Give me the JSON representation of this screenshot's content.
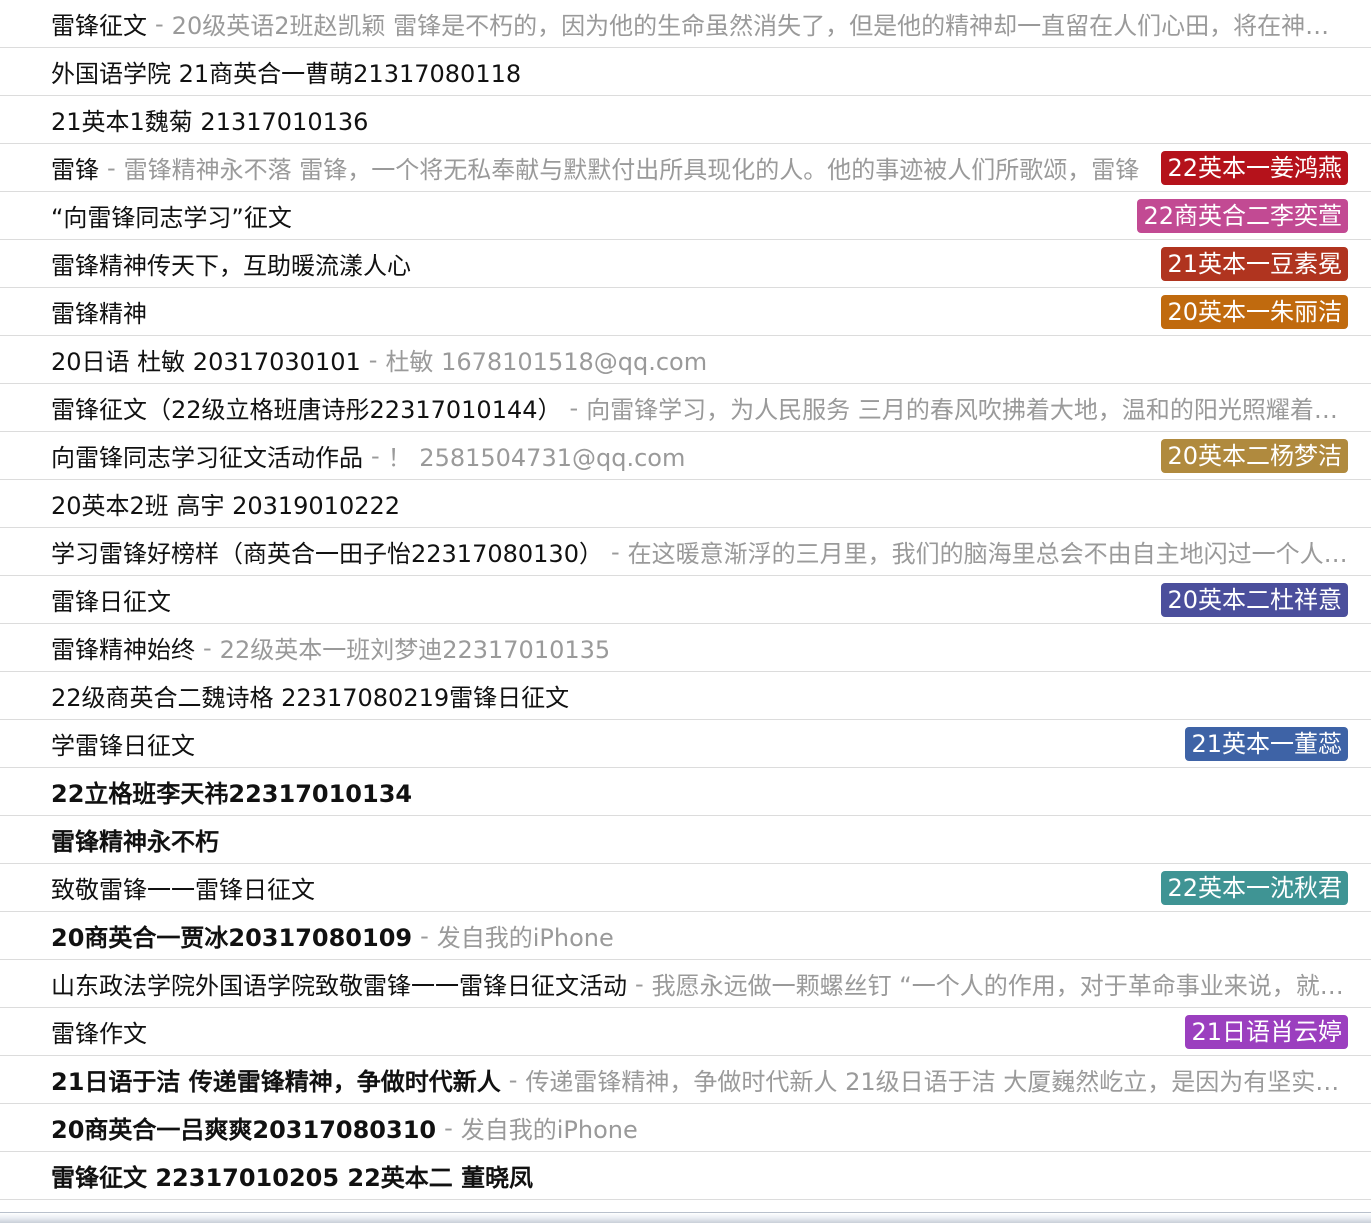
{
  "rows": [
    {
      "subject": "雷锋征文",
      "snippet": "20级英语2班赵凯颖  雷锋是不朽的，因为他的生命虽然消失了，但是他的精神却一直留在人们心田，将在神州大地上永放光芒",
      "tag": "",
      "tag_color": "",
      "unread": false
    },
    {
      "subject": "外国语学院 21商英合一曹萌21317080118",
      "snippet": "",
      "tag": "",
      "tag_color": "",
      "unread": false
    },
    {
      "subject": "21英本1魏菊 21317010136",
      "snippet": "",
      "tag": "",
      "tag_color": "",
      "unread": false
    },
    {
      "subject": "雷锋",
      "snippet": "雷锋精神永不落     雷锋，一个将无私奉献与默默付出所具现化的人。他的事迹被人们所歌颂，雷锋",
      "tag": "22英本一姜鸿燕",
      "tag_color": "#b5121b",
      "unread": false
    },
    {
      "subject": "“向雷锋同志学习”征文",
      "snippet": "",
      "tag": "22商英合二李奕萱",
      "tag_color": "#c24a93",
      "unread": false
    },
    {
      "subject": "雷锋精神传天下，互助暖流漾人心",
      "snippet": "",
      "tag": "21英本一豆素冕",
      "tag_color": "#b0341f",
      "unread": false
    },
    {
      "subject": "雷锋精神",
      "snippet": "",
      "tag": "20英本一朱丽洁",
      "tag_color": "#c06a0e",
      "unread": false
    },
    {
      "subject": "20日语 杜敏 20317030101",
      "snippet": "杜敏 1678101518@qq.com",
      "tag": "",
      "tag_color": "",
      "unread": false
    },
    {
      "subject": "雷锋征文（22级立格班唐诗彤22317010144）",
      "snippet": "向雷锋学习，为人民服务 三月的春风吹拂着大地，温和的阳光照耀着大地",
      "tag": "",
      "tag_color": "",
      "unread": false
    },
    {
      "subject": "向雷锋同志学习征文活动作品",
      "snippet": "！  2581504731@qq.com",
      "tag": "20英本二杨梦洁",
      "tag_color": "#b08a3e",
      "unread": false
    },
    {
      "subject": "20英本2班 高宇 20319010222",
      "snippet": "",
      "tag": "",
      "tag_color": "",
      "unread": false
    },
    {
      "subject": "学习雷锋好榜样（商英合一田子怡22317080130）",
      "snippet": "在这暖意渐浮的三月里，我们的脑海里总会不由自主地闪过一个人的身影",
      "tag": "",
      "tag_color": "",
      "unread": false
    },
    {
      "subject": "雷锋日征文",
      "snippet": "",
      "tag": "20英本二杜祥意",
      "tag_color": "#4b4f9c",
      "unread": false
    },
    {
      "subject": "雷锋精神始终",
      "snippet": "22级英本一班刘梦迪22317010135",
      "tag": "",
      "tag_color": "",
      "unread": false
    },
    {
      "subject": "22级商英合二魏诗格 22317080219雷锋日征文",
      "snippet": "",
      "tag": "",
      "tag_color": "",
      "unread": false
    },
    {
      "subject": "学雷锋日征文",
      "snippet": "",
      "tag": "21英本一董蕊",
      "tag_color": "#3e63a6",
      "unread": false
    },
    {
      "subject": "22立格班李天祎22317010134",
      "snippet": "",
      "tag": "",
      "tag_color": "",
      "unread": true
    },
    {
      "subject": "雷锋精神永不朽",
      "snippet": "",
      "tag": "",
      "tag_color": "",
      "unread": true
    },
    {
      "subject": "致敬雷锋一一雷锋日征文",
      "snippet": "",
      "tag": "22英本一沈秋君",
      "tag_color": "#3f9494",
      "unread": false
    },
    {
      "subject": "20商英合一贾冰20317080109",
      "snippet": "发自我的iPhone",
      "tag": "",
      "tag_color": "",
      "unread": true
    },
    {
      "subject": "山东政法学院外国语学院致敬雷锋一一雷锋日征文活动",
      "snippet": "我愿永远做一颗螺丝钉 “一个人的作用，对于革命事业来说，就如一架机器上的一颗螺丝钉",
      "tag": "",
      "tag_color": "",
      "unread": false
    },
    {
      "subject": "雷锋作文",
      "snippet": "",
      "tag": "21日语肖云婷",
      "tag_color": "#9b3fbf",
      "unread": false
    },
    {
      "subject": "21日语于洁 传递雷锋精神，争做时代新人",
      "snippet": "传递雷锋精神，争做时代新人  21级日语于洁  大厦巍然屹立，是因为有坚实的基础",
      "tag": "",
      "tag_color": "",
      "unread": true
    },
    {
      "subject": "20商英合一吕爽爽20317080310",
      "snippet": "发自我的iPhone",
      "tag": "",
      "tag_color": "",
      "unread": true
    },
    {
      "subject": "雷锋征文   22317010205 22英本二 董晓凤",
      "snippet": "",
      "tag": "",
      "tag_color": "",
      "unread": true
    }
  ],
  "separator": "-"
}
